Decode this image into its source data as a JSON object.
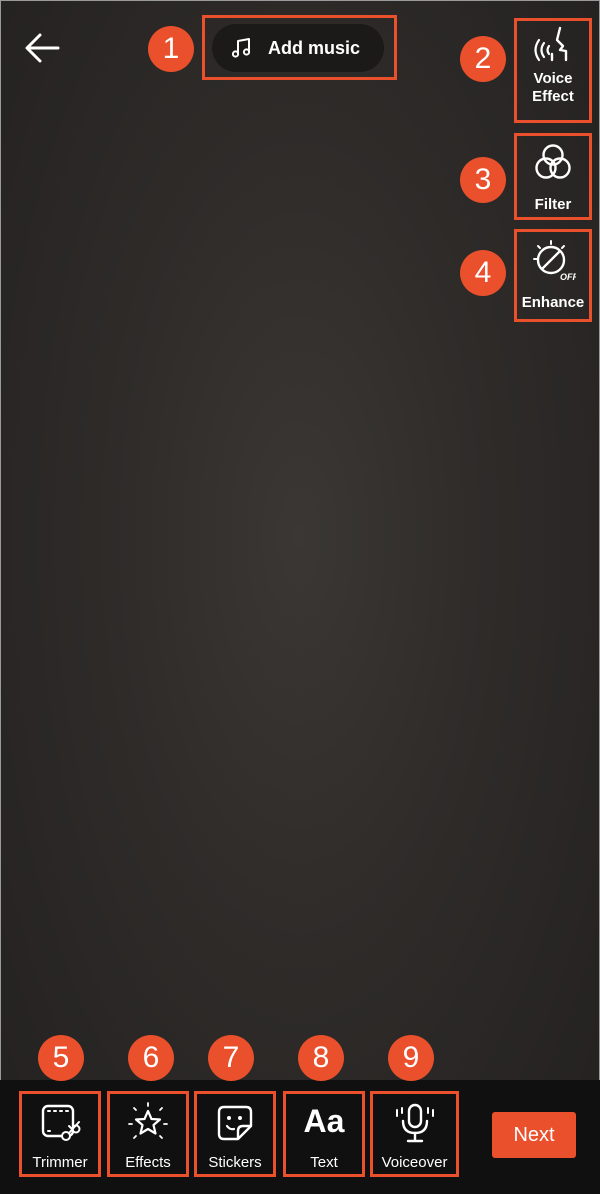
{
  "header": {
    "add_music_label": "Add music"
  },
  "side_tools": [
    {
      "label_line1": "Voice",
      "label_line2": "Effect",
      "badge": "2"
    },
    {
      "label": "Filter",
      "badge": "3"
    },
    {
      "label": "Enhance",
      "badge": "4"
    }
  ],
  "bottom_tools": [
    {
      "label": "Trimmer",
      "badge": "5"
    },
    {
      "label": "Effects",
      "badge": "6"
    },
    {
      "label": "Stickers",
      "badge": "7"
    },
    {
      "label": "Text",
      "badge": "8",
      "glyph": "Aa"
    },
    {
      "label": "Voiceover",
      "badge": "9"
    }
  ],
  "music_badge": "1",
  "next_label": "Next",
  "icons": {
    "back": "arrow-left-icon",
    "music": "music-note-icon",
    "voice_effect": "voice-wave-icon",
    "filter": "three-circles-icon",
    "enhance": "enhance-dial-off-icon",
    "trimmer": "film-scissors-icon",
    "effects": "sparkle-star-icon",
    "stickers": "sticker-face-icon",
    "voiceover": "microphone-icon"
  },
  "colors": {
    "accent": "#e9502b",
    "background": "#2e2b29",
    "bar": "#101010"
  }
}
